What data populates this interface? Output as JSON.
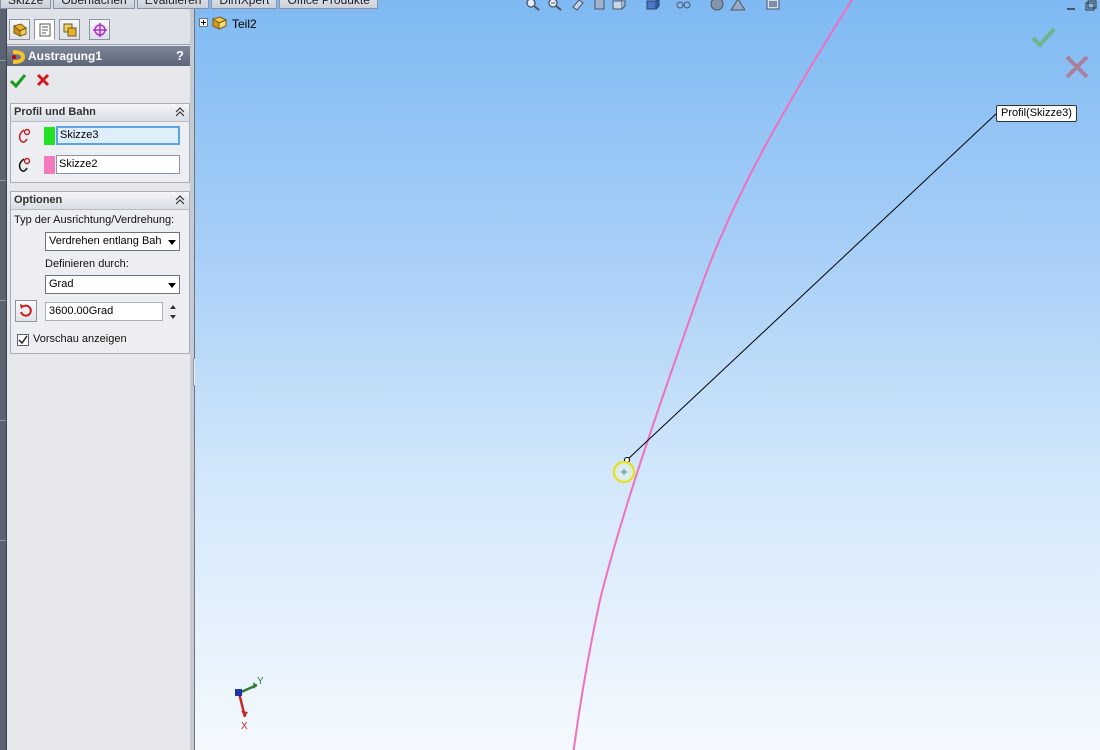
{
  "top_tabs": [
    "Skizze",
    "Oberflächen",
    "Evaluieren",
    "DimXpert",
    "Office Produkte"
  ],
  "property_manager": {
    "title": "Austragung1",
    "help": "?",
    "groups": {
      "profile_path": {
        "label": "Profil und Bahn",
        "profile_value": "Skizze3",
        "path_value": "Skizze2",
        "profile_color": "#22e022",
        "path_color": "#f27bbd"
      },
      "options": {
        "label": "Optionen",
        "orientation_label": "Typ der Ausrichtung/Verdrehung:",
        "orientation_value": "Verdrehen entlang Bahn",
        "define_label": "Definieren durch:",
        "define_value": "Grad",
        "angle_value": "3600.00Grad",
        "preview_label": "Vorschau anzeigen",
        "preview_checked": true
      }
    }
  },
  "graphics": {
    "tree_root": "Teil2",
    "callout_label": "Profil(Skizze3)",
    "triad_labels": {
      "x": "X",
      "y": "Y"
    }
  },
  "colors": {
    "path_curve": "#f06fbf",
    "leader_line": "#000000",
    "point_highlight": "#e8e200",
    "ok_green": "#1a9a1a",
    "cancel_red": "#d21a1a"
  }
}
